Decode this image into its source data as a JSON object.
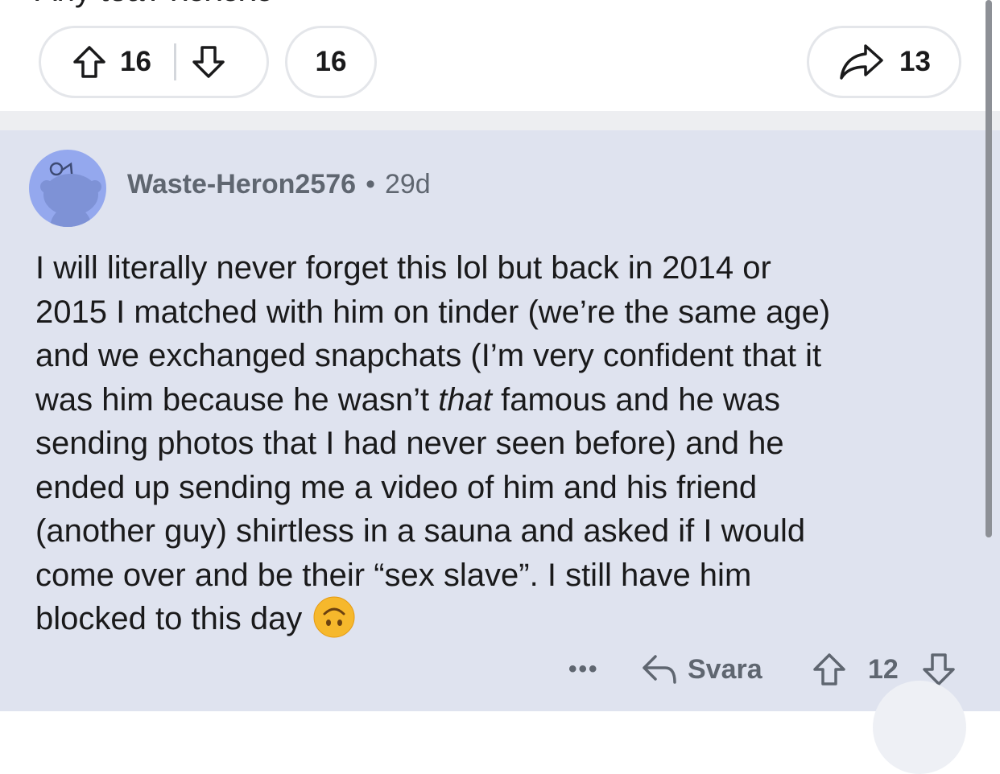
{
  "post": {
    "cut_text": "Any tea? xoxoxo",
    "upvotes": "16",
    "comments": "16",
    "shares": "13"
  },
  "comment": {
    "username": "Waste-Heron2576",
    "separator": "•",
    "age": "29d",
    "lines": [
      "I will literally never forget this lol but back in 2014 or",
      "2015 I matched with him on tinder (we’re the same age)",
      "and we exchanged snapchats (I’m very confident that it"
    ],
    "line4_before": "was him because he wasn’t ",
    "line4_italic": "that",
    "line4_after": " famous and he was",
    "lines2": [
      "sending photos that I had never seen before) and he",
      "ended up sending me a video of him and his friend",
      "(another guy) shirtless in a sauna and asked if I would",
      "come over and be their “sex slave”. I still have him"
    ],
    "last_line": "blocked to this day",
    "emoji": "upside-down-face",
    "more_label": "•••",
    "reply_label": "Svara",
    "score": "12"
  },
  "icons": {
    "upvote": "arrow-up-outline",
    "downvote": "arrow-down-outline",
    "share": "share-arrow",
    "reply": "reply-arrow",
    "avatar": "snoo-avatar"
  },
  "colors": {
    "comment_bg": "#dfe3ef",
    "avatar_bg": "#94a8ee",
    "meta_text": "#5f6670"
  }
}
